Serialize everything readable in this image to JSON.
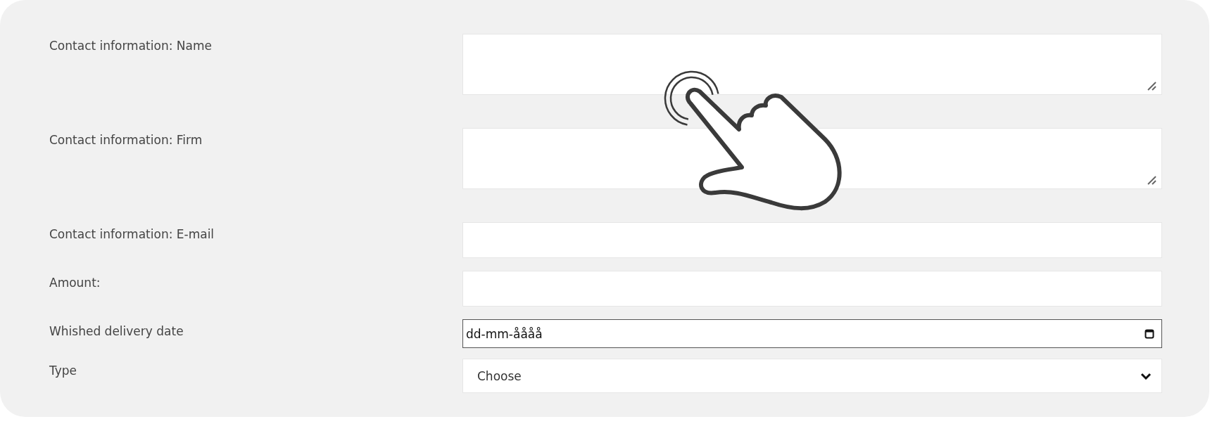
{
  "form": {
    "rows": [
      {
        "label": "Contact information: Name",
        "kind": "textarea"
      },
      {
        "label": "Contact information: Firm",
        "kind": "textarea"
      },
      {
        "label": "Contact information: E-mail",
        "kind": "text"
      },
      {
        "label": "Amount:",
        "kind": "text"
      },
      {
        "label": "Whished delivery date",
        "kind": "date",
        "placeholder": "dd-mm-åååå"
      },
      {
        "label": "Type",
        "kind": "select",
        "value": "Choose"
      }
    ]
  }
}
